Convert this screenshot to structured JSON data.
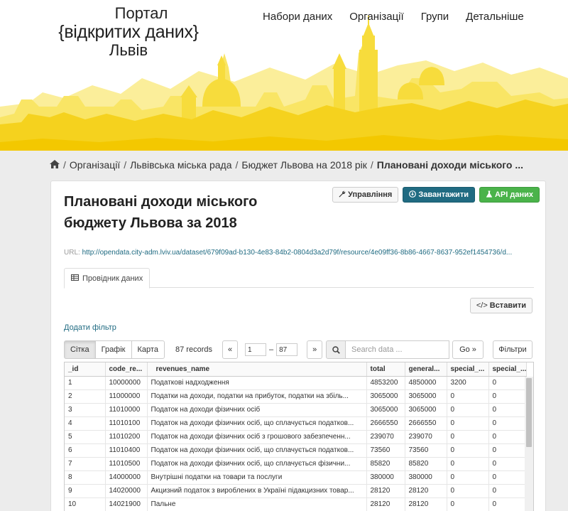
{
  "logo": {
    "line1": "Портал",
    "line2": "{відкритих даних}",
    "line3": "Львів"
  },
  "nav": [
    "Набори даних",
    "Організації",
    "Групи",
    "Детальніше"
  ],
  "breadcrumb": {
    "items": [
      "Організації",
      "Львівська міська рада",
      "Бюджет Львова на 2018 рік"
    ],
    "active": "Плановані доходи міського ..."
  },
  "resource": {
    "title": "Плановані доходи міського бюджету Львова за 2018",
    "url_label": "URL:",
    "url": "http://opendata.city-adm.lviv.ua/dataset/679f09ad-b130-4e83-84b2-0804d3a2d79f/resource/4e09ff36-8b86-4667-8637-952ef1454736/d..."
  },
  "actions": {
    "manage": "Управління",
    "download": "Завантажити",
    "api": "API даних"
  },
  "tab_label": "Провідник даних",
  "embed_label": "Вставити",
  "add_filter": "Додати фільтр",
  "views": [
    "Сітка",
    "Графік",
    "Карта"
  ],
  "records": "87 records",
  "pager": {
    "prev": "«",
    "from": "1",
    "to": "87",
    "next": "»"
  },
  "search_placeholder": "Search data ...",
  "go_label": "Go »",
  "filters_label": "Фільтри",
  "colors": {
    "accent": "#206b82",
    "success": "#4ab34a",
    "skyline": "#f9e04a"
  },
  "table": {
    "columns": [
      "_id",
      "code_re...",
      "revenues_name",
      "total",
      "general...",
      "special_...",
      "special_..."
    ],
    "rows": [
      [
        "1",
        "10000000",
        "Податкові надходження",
        "4853200",
        "4850000",
        "3200",
        "0"
      ],
      [
        "2",
        "11000000",
        "Податки на доходи, податки на прибуток, податки на збіль...",
        "3065000",
        "3065000",
        "0",
        "0"
      ],
      [
        "3",
        "11010000",
        "Податок на доходи фізичних осіб",
        "3065000",
        "3065000",
        "0",
        "0"
      ],
      [
        "4",
        "11010100",
        "Податок на доходи фізичних осіб, що сплачується податков...",
        "2666550",
        "2666550",
        "0",
        "0"
      ],
      [
        "5",
        "11010200",
        "Податок на доходи фізичних осіб з грошового забезпеченн...",
        "239070",
        "239070",
        "0",
        "0"
      ],
      [
        "6",
        "11010400",
        "Податок на доходи фізичних осіб, що сплачується податков...",
        "73560",
        "73560",
        "0",
        "0"
      ],
      [
        "7",
        "11010500",
        "Податок на доходи фізичних осіб, що сплачується фізични...",
        "85820",
        "85820",
        "0",
        "0"
      ],
      [
        "8",
        "14000000",
        "Внутрішні податки на товари та послуги",
        "380000",
        "380000",
        "0",
        "0"
      ],
      [
        "9",
        "14020000",
        "Акцизний податок з вироблених в Україні підакцизних товар...",
        "28120",
        "28120",
        "0",
        "0"
      ],
      [
        "10",
        "14021900",
        "Пальне",
        "28120",
        "28120",
        "0",
        "0"
      ]
    ]
  }
}
